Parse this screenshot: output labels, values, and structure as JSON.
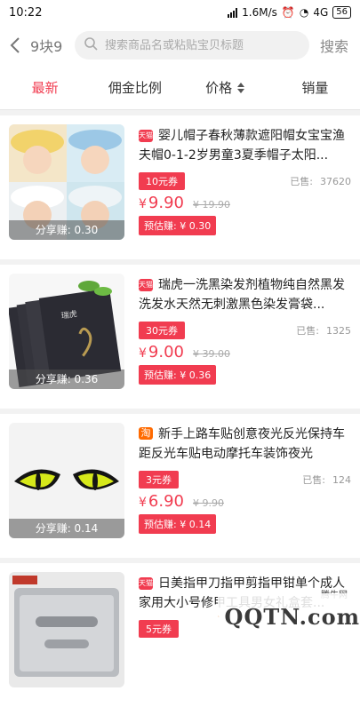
{
  "status": {
    "time": "10:22",
    "speed": "1.6M/s",
    "network": "4G",
    "battery": "56"
  },
  "header": {
    "back_icon": "chevron-left-icon",
    "title": "9块9",
    "search_placeholder": "搜索商品名或粘贴宝贝标题",
    "search_button": "搜索"
  },
  "tabs": [
    {
      "label": "最新",
      "active": true
    },
    {
      "label": "佣金比例"
    },
    {
      "label": "价格"
    },
    {
      "label": "销量"
    }
  ],
  "items": [
    {
      "platform": "天猫",
      "title": "婴儿帽子春秋薄款遮阳帽女宝宝渔夫帽0-1-2岁男童3夏季帽子太阳...",
      "coupon": "10元券",
      "sold_label": "已售:",
      "sold": "37620",
      "price": "9.90",
      "old_price": "¥ 19.90",
      "estimate": "预估赚: ¥ 0.30",
      "share": "分享赚: 0.30"
    },
    {
      "platform": "天猫",
      "title": "瑞虎一洗黑染发剂植物纯自然黑发洗发水天然无刺激黑色染发膏袋...",
      "coupon": "30元券",
      "sold_label": "已售:",
      "sold": "1325",
      "price": "9.00",
      "old_price": "¥ 39.00",
      "estimate": "预估赚: ¥ 0.36",
      "share": "分享赚: 0.36"
    },
    {
      "platform": "淘",
      "title": "新手上路车贴创意夜光反光保持车距反光车贴电动摩托车装饰夜光",
      "coupon": "3元券",
      "sold_label": "已售:",
      "sold": "124",
      "price": "6.90",
      "old_price": "¥ 9.90",
      "estimate": "预估赚: ¥ 0.14",
      "share": "分享赚: 0.14"
    },
    {
      "platform": "天猫",
      "title": "日美指甲刀指甲剪指甲钳单个成人家用大小号修甲工具男女礼盒套...",
      "coupon": "5元券",
      "sold_label": "",
      "sold": "",
      "price": "",
      "old_price": "",
      "estimate": "",
      "share": ""
    }
  ],
  "currency": "¥",
  "watermark": {
    "brand": "QQTN.com",
    "small": "腾牛网"
  },
  "colors": {
    "accent": "#f13c50"
  }
}
